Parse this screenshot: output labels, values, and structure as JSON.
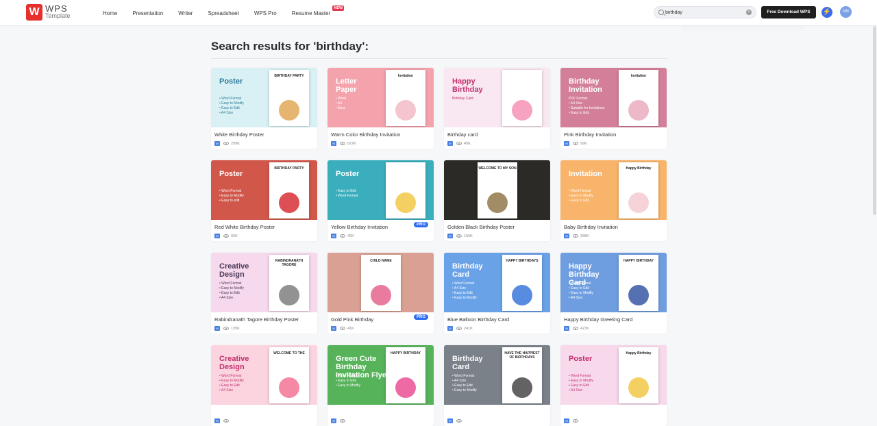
{
  "header": {
    "logo_line1": "WPS",
    "logo_line2": "Template",
    "nav": [
      "Home",
      "Presentation",
      "Writer",
      "Spreadsheet",
      "WPS Pro",
      "Resume Master"
    ],
    "new_badge": "NEW",
    "search_value": "birthday",
    "download_label": "Free Download WPS",
    "avatar_initials": "NN"
  },
  "results": {
    "heading": "Search results for 'birthday':"
  },
  "cards": [
    {
      "title": "White Birthday Poster",
      "views": "299K",
      "pro": "",
      "thumb_title": "Poster",
      "bullets": "• Word Format\n• Easy to Modify\n• Easy to Edit\n• A4 Size",
      "doc_title": "BIRTHDAY PARTY",
      "bg": "#d9f1f4",
      "accent": "#2b7a9c",
      "blob": "#e0a34c"
    },
    {
      "title": "Warm Color Birthday Invitation",
      "views": "822K",
      "pro": "",
      "thumb_title": "Letter\nPaper",
      "bullets": "• Word\n• A4\n• Easy",
      "doc_title": "Invitation",
      "bg": "#f4a3ad",
      "accent": "#ffffff",
      "blob": "#f2b6c0"
    },
    {
      "title": "Birthday card",
      "views": "45K",
      "pro": "",
      "thumb_title": "Happy\nBirthday",
      "bullets": "Birthday Card",
      "doc_title": "",
      "bg": "#f9e7f1",
      "accent": "#c2306e",
      "blob": "#f48bb0"
    },
    {
      "title": "Pink Birthday Invitation",
      "views": "99K",
      "pro": "",
      "thumb_title": "Birthday\nInvitation",
      "bullets": "PDF Format\n• A4 Size\n• Suitable for Invitations\n• Easy to Edit",
      "doc_title": "Invitation",
      "bg": "#d47f9a",
      "accent": "#ffffff",
      "blob": "#e9a7ba"
    },
    {
      "title": "Red White Birthday Poster",
      "views": "65K",
      "pro": "",
      "thumb_title": "Poster",
      "bullets": "• Word Format\n• Easy to Modify\n• Easy to edit",
      "doc_title": "BIRTHDAY PARTY",
      "bg": "#d1574a",
      "accent": "#ffffff",
      "blob": "#d4232a"
    },
    {
      "title": "Yellow Birthday Invitation",
      "views": "40K",
      "pro": "PRO",
      "thumb_title": "Poster",
      "bullets": "• Easy to Edit\n• Word Format",
      "doc_title": "",
      "bg": "#3aaebc",
      "accent": "#ffffff",
      "blob": "#f0c43a"
    },
    {
      "title": "Golden Black Birthday Poster",
      "views": "155K",
      "pro": "",
      "thumb_title": "",
      "bullets": "",
      "doc_title": "WELCOME TO MY SON",
      "bg": "#2c2a27",
      "accent": "#c6a56b",
      "blob": "#8b6f3f"
    },
    {
      "title": "Baby Birthday Invitation",
      "views": "288K",
      "pro": "",
      "thumb_title": "Invitation",
      "bullets": "• Word Format\n• Easy to Modify\n• Easy to Edit",
      "doc_title": "Happy Birthday",
      "bg": "#f8b46a",
      "accent": "#ffffff",
      "blob": "#f3c8d0"
    },
    {
      "title": "Rabindranath Tagore Birthday Poster",
      "views": "135K",
      "pro": "",
      "thumb_title": "Creative\nDesign",
      "bullets": "• Word Format\n• Easy to Modify\n• Easy to Edit\n• A4 Size",
      "doc_title": "RABINDRANATH TAGORE",
      "bg": "#f6d9ec",
      "accent": "#4a3a5a",
      "blob": "#777777"
    },
    {
      "title": "Gold Pink Birthday",
      "views": "41K",
      "pro": "PRO",
      "thumb_title": "",
      "bullets": "",
      "doc_title": "CHILD NAME",
      "bg": "#d9a093",
      "accent": "#ffffff",
      "blob": "#e35b86"
    },
    {
      "title": "Blue Balloon Birthday Card",
      "views": "241K",
      "pro": "",
      "thumb_title": "Birthday\nCard",
      "bullets": "• Word Format\n• A4 Size\n• Easy to Edit\n• Easy to Modify",
      "doc_title": "HAPPY BIRTHDAYS",
      "bg": "#6aa2e8",
      "accent": "#ffffff",
      "blob": "#2d6fd8"
    },
    {
      "title": "Happy Birthday Greeting Card",
      "views": "423K",
      "pro": "",
      "thumb_title": "Happy\nBirthday\nCard",
      "bullets": "• Word Format\n• Easy to Edit\n• Easy to Modify\n• A4 Size",
      "doc_title": "HAPPY BIRTHDAY",
      "bg": "#6f9ee0",
      "accent": "#ffffff",
      "blob": "#2c4d9e"
    },
    {
      "title": "",
      "views": "",
      "pro": "",
      "thumb_title": "Creative\nDesign",
      "bullets": "• Word Format\n• Easy to Modify\n• Easy to Edit\n• A4 Size",
      "doc_title": "WELCOME TO THE",
      "bg": "#fbd4df",
      "accent": "#c2306e",
      "blob": "#f26a8f"
    },
    {
      "title": "",
      "views": "",
      "pro": "",
      "thumb_title": "Green Cute\nBirthday\nInvitation Flyer",
      "bullets": "• Word Format\n• Easy to Edit\n• Easy to Modify",
      "doc_title": "HAPPY BIRTHDAY",
      "bg": "#57b35a",
      "accent": "#ffffff",
      "blob": "#e9458f"
    },
    {
      "title": "",
      "views": "",
      "pro": "",
      "thumb_title": "Birthday\nCard",
      "bullets": "• Word Format\n• A4 Size\n• Easy to Edit\n• Easy to Modify",
      "doc_title": "HAVE THE HAPPIEST OF BIRTHDAYS",
      "bg": "#7b8189",
      "accent": "#ffffff",
      "blob": "#3c3c3c"
    },
    {
      "title": "",
      "views": "",
      "pro": "",
      "thumb_title": "Poster",
      "bullets": "• Word Format\n• Easy to Modify\n• Easy to Edit\n• A4 Size",
      "doc_title": "Happy Birthday",
      "bg": "#f8d9ec",
      "accent": "#c2306e",
      "blob": "#f0c43a"
    }
  ]
}
